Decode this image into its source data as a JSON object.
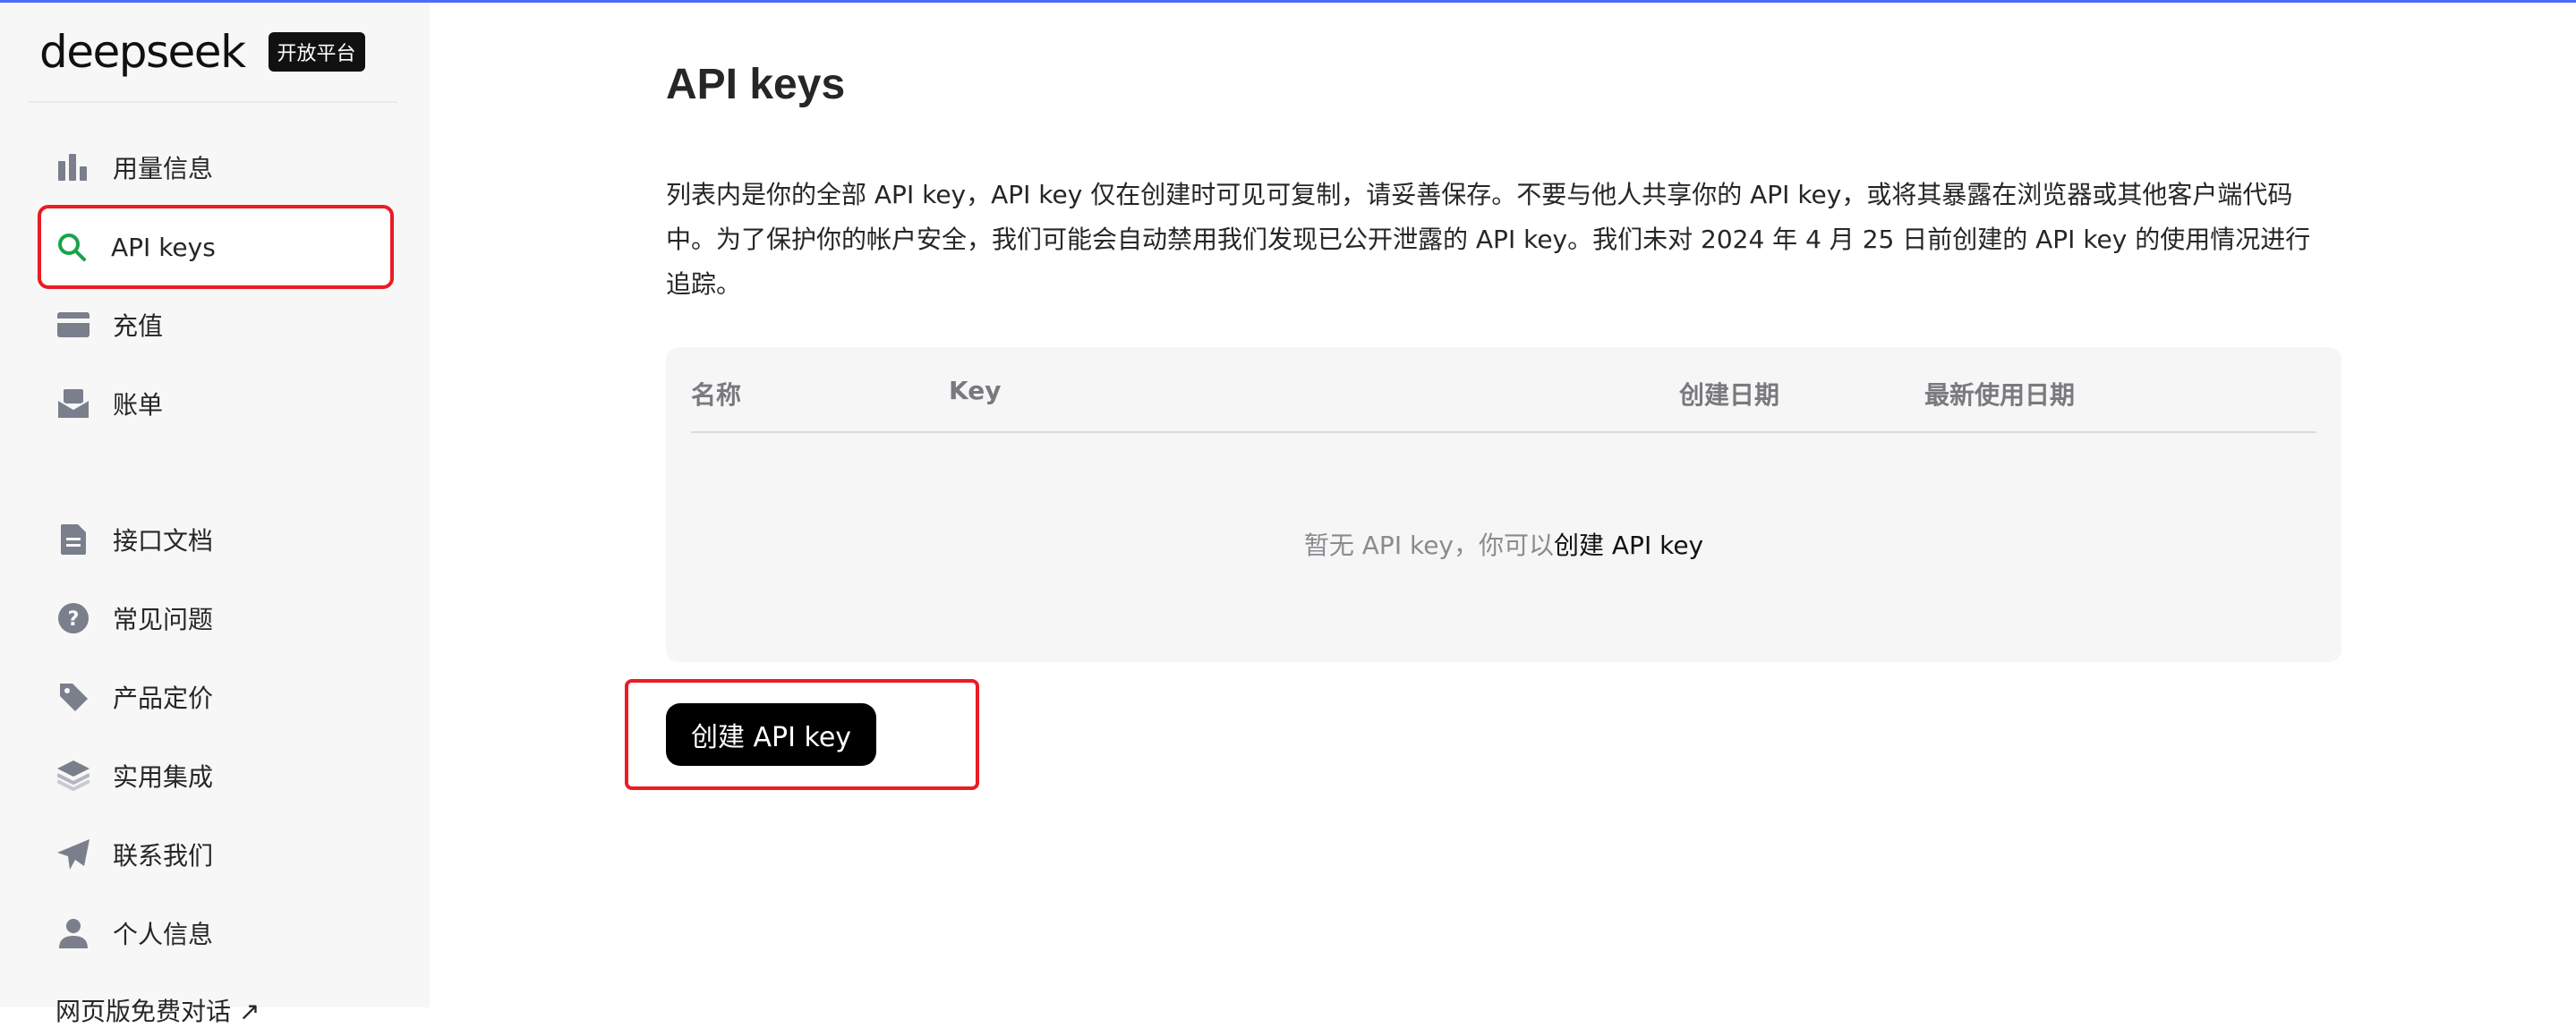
{
  "brand": {
    "name": "deepseek",
    "badge": "开放平台"
  },
  "sidebar": {
    "items": [
      {
        "label": "用量信息",
        "icon": "bar-chart-icon"
      },
      {
        "label": "API keys",
        "icon": "search-icon",
        "active": true
      },
      {
        "label": "充值",
        "icon": "wallet-icon"
      },
      {
        "label": "账单",
        "icon": "envelope-icon"
      },
      {
        "label": "接口文档",
        "icon": "document-icon"
      },
      {
        "label": "常见问题",
        "icon": "help-icon"
      },
      {
        "label": "产品定价",
        "icon": "tag-icon"
      },
      {
        "label": "实用集成",
        "icon": "layers-icon"
      },
      {
        "label": "联系我们",
        "icon": "send-icon"
      },
      {
        "label": "个人信息",
        "icon": "user-icon"
      }
    ],
    "bottom_link": "网页版免费对话 ↗"
  },
  "main": {
    "title": "API keys",
    "description": "列表内是你的全部 API key，API key 仅在创建时可见可复制，请妥善保存。不要与他人共享你的 API key，或将其暴露在浏览器或其他客户端代码中。为了保护你的帐户安全，我们可能会自动禁用我们发现已公开泄露的 API key。我们未对 2024 年 4 月 25 日前创建的 API key 的使用情况进行追踪。",
    "table": {
      "columns": [
        "名称",
        "Key",
        "创建日期",
        "最新使用日期"
      ],
      "empty_text": "暂无 API key，你可以",
      "empty_link": "创建 API key"
    },
    "create_button": "创建 API key"
  },
  "colors": {
    "accent_line": "#4d6bfe",
    "highlight": "#ea1c24",
    "active_icon": "#1aa34a",
    "button_bg": "#000000"
  }
}
